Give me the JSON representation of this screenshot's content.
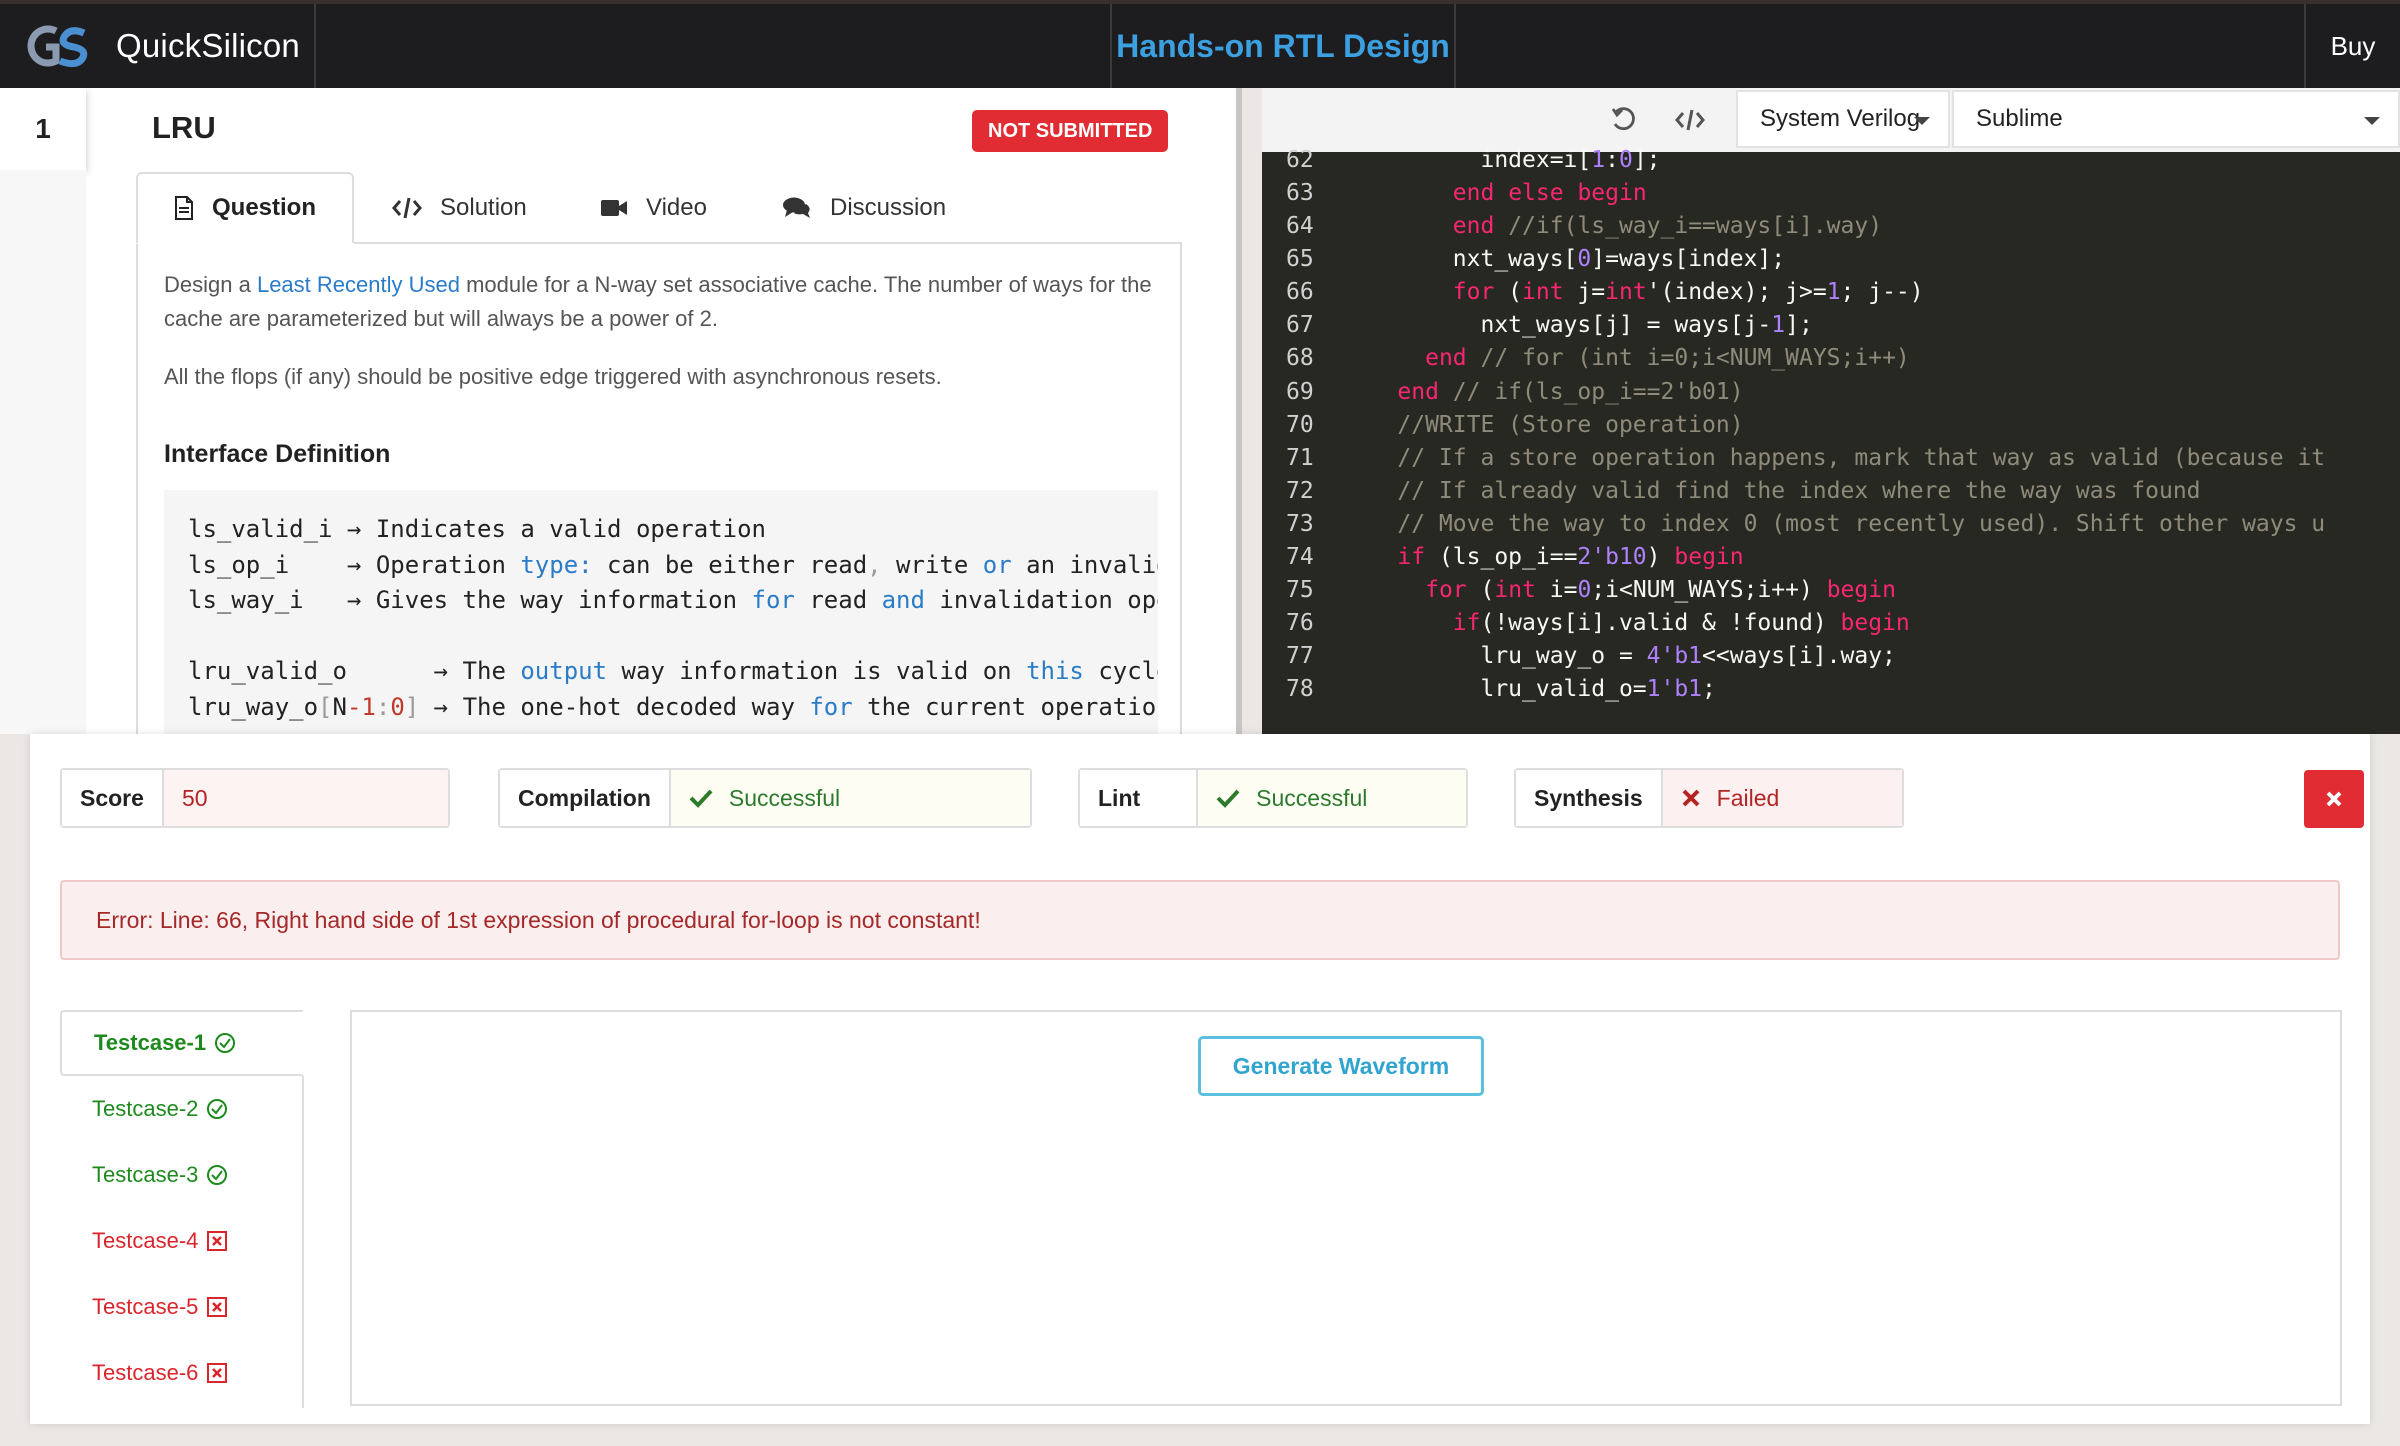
{
  "navbar": {
    "brand_name": "QuickSilicon",
    "course_title": "Hands-on RTL Design",
    "buy_label": "Buy"
  },
  "problem": {
    "number": "1",
    "title": "LRU",
    "status": "NOT SUBMITTED",
    "tabs": [
      {
        "label": "Question",
        "icon": "document-icon",
        "active": true
      },
      {
        "label": "Solution",
        "icon": "code-icon",
        "active": false
      },
      {
        "label": "Video",
        "icon": "video-camera-icon",
        "active": false
      },
      {
        "label": "Discussion",
        "icon": "comments-icon",
        "active": false
      }
    ],
    "description_pre": "Design a ",
    "description_link": "Least Recently Used",
    "description_post": " module for a N-way set associative cache. The number of ways for the cache are parameterized but will always be a power of 2.",
    "flops_note": "All the flops (if any) should be positive edge triggered with asynchronous resets.",
    "interface_heading": "Interface Definition",
    "interface": [
      {
        "signal": "ls_valid_i",
        "desc": "Indicates a valid operation"
      },
      {
        "signal": "ls_op_i",
        "desc": "Operation type: can be either read, write or an invalidate"
      },
      {
        "signal": "ls_way_i",
        "desc": "Gives the way information for read and invalidation operation"
      },
      {
        "signal": "lru_valid_o",
        "desc": "The output way information is valid on this cycle"
      },
      {
        "signal": "lru_way_o[N-1:0]",
        "desc": "The one-hot decoded way for the current operation"
      }
    ]
  },
  "editor": {
    "language": "System Verilog",
    "keymap": "Sublime",
    "lines": [
      {
        "n": "62",
        "text": "          index=i[1:0];"
      },
      {
        "n": "63",
        "text": "        end else begin"
      },
      {
        "n": "64",
        "text": "        end //if(ls_way_i==ways[i].way)"
      },
      {
        "n": "65",
        "text": "        nxt_ways[0]=ways[index];"
      },
      {
        "n": "66",
        "text": "        for (int j=int'(index); j>=1; j--)"
      },
      {
        "n": "67",
        "text": "          nxt_ways[j] = ways[j-1];"
      },
      {
        "n": "68",
        "text": "      end // for (int i=0;i<NUM_WAYS;i++)"
      },
      {
        "n": "69",
        "text": "    end // if(ls_op_i==2'b01)"
      },
      {
        "n": "70",
        "text": "    //WRITE (Store operation)"
      },
      {
        "n": "71",
        "text": "    // If a store operation happens, mark that way as valid (because it"
      },
      {
        "n": "72",
        "text": "    // If already valid find the index where the way was found"
      },
      {
        "n": "73",
        "text": "    // Move the way to index 0 (most recently used). Shift other ways u"
      },
      {
        "n": "74",
        "text": "    if (ls_op_i==2'b10) begin"
      },
      {
        "n": "75",
        "text": "      for (int i=0;i<NUM_WAYS;i++) begin"
      },
      {
        "n": "76",
        "text": "        if(!ways[i].valid & !found) begin"
      },
      {
        "n": "77",
        "text": "          lru_way_o = 4'b1<<ways[i].way;"
      },
      {
        "n": "78",
        "text": "          lru_valid_o=1'b1;"
      }
    ]
  },
  "results": {
    "score_label": "Score",
    "score_value": "50",
    "compilation_label": "Compilation",
    "compilation_value": "Successful",
    "lint_label": "Lint",
    "lint_value": "Successful",
    "synthesis_label": "Synthesis",
    "synthesis_value": "Failed",
    "error_message": "Error: Line: 66, Right hand side of 1st expression of procedural for-loop is not constant!",
    "generate_waveform_label": "Generate Waveform",
    "testcases": [
      {
        "label": "Testcase-1",
        "status": "pass"
      },
      {
        "label": "Testcase-2",
        "status": "pass"
      },
      {
        "label": "Testcase-3",
        "status": "pass"
      },
      {
        "label": "Testcase-4",
        "status": "fail"
      },
      {
        "label": "Testcase-5",
        "status": "fail"
      },
      {
        "label": "Testcase-6",
        "status": "fail"
      }
    ]
  },
  "colors": {
    "accent_blue": "#3b9fe0",
    "danger_red": "#e02c32",
    "success_green": "#2d7a2d",
    "editor_bg": "#272822"
  }
}
